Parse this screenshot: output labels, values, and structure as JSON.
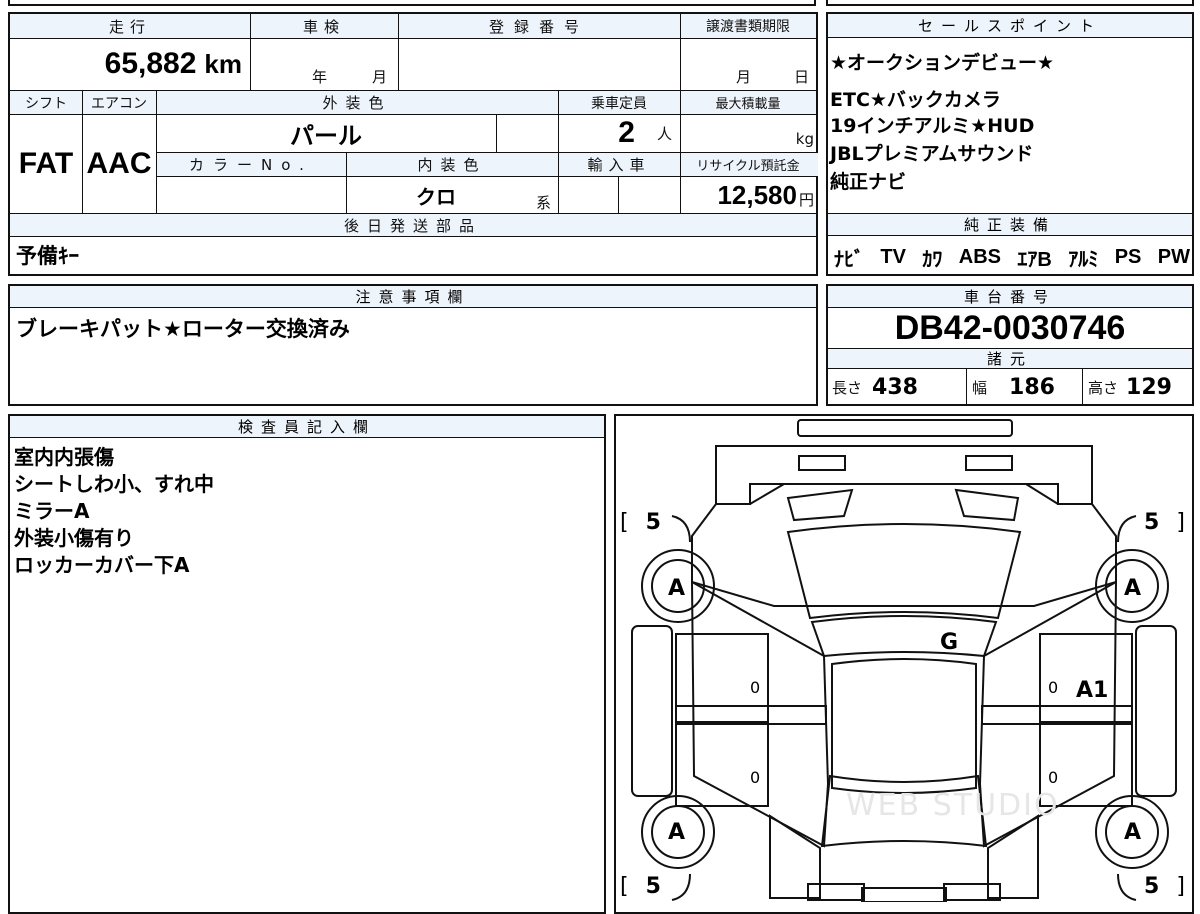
{
  "mileage": {
    "label": "走行",
    "value": "65,882",
    "unit": "km"
  },
  "inspection": {
    "label": "車検",
    "year_label": "年",
    "month_label": "月"
  },
  "registration": {
    "label": "登録番号",
    "value": ""
  },
  "transfer_deadline": {
    "label": "譲渡書類期限",
    "month_label": "月",
    "day_label": "日"
  },
  "shift": {
    "label": "シフト",
    "value": "FAT"
  },
  "aircon": {
    "label": "エアコン",
    "value": "AAC"
  },
  "exterior_color": {
    "label": "外装色",
    "value": "パール"
  },
  "capacity": {
    "label": "乗車定員",
    "value": "2",
    "unit": "人"
  },
  "max_load": {
    "label": "最大積載量",
    "unit": "kg"
  },
  "color_no": {
    "label": "カラーNo."
  },
  "interior_color": {
    "label": "内装色",
    "value": "クロ",
    "suffix": "系"
  },
  "import": {
    "label": "輸入車"
  },
  "recycle": {
    "label": "リサイクル預託金",
    "value": "12,580",
    "unit": "円"
  },
  "sales_points": {
    "label": "セールスポイント",
    "lines": [
      "★オークションデビュー★",
      "",
      "ETC★バックカメラ",
      "19インチアルミ★HUD",
      "JBLプレミアムサウンド",
      "純正ナビ"
    ]
  },
  "later_parts": {
    "label": "後日発送部品",
    "value": "予備ｷｰ"
  },
  "equipment": {
    "label": "純正装備",
    "items": [
      "ﾅﾋﾞ",
      "TV",
      "ｶﾜ",
      "ABS",
      "ｴｱB",
      "ｱﾙﾐ",
      "PS",
      "PW"
    ]
  },
  "notes": {
    "label": "注意事項欄",
    "value": "ブレーキパット★ローター交換済み"
  },
  "chassis": {
    "label": "車台番号",
    "value": "DB42-0030746"
  },
  "specs": {
    "label": "諸元",
    "length_label": "長さ",
    "length": "438",
    "width_label": "幅",
    "width": "186",
    "height_label": "高さ",
    "height": "129"
  },
  "inspector": {
    "label": "検査員記入欄",
    "lines": [
      "室内内張傷",
      "シートしわ小、すれ中",
      "ミラーA",
      "外装小傷有り",
      "ロッカーカバー下A"
    ]
  },
  "diagram": {
    "tire_fl": "5",
    "tire_fr": "5",
    "tire_rl": "5",
    "tire_rr": "5",
    "bracket_open": "[",
    "bracket_close": "]",
    "wheel_fl": "A",
    "wheel_fr": "A",
    "wheel_rl": "A",
    "wheel_rr": "A",
    "windshield": "G",
    "door_fl": "0",
    "door_fr": "0",
    "door_rl": "0",
    "door_rr": "0",
    "door_fr_damage": "A1",
    "watermark": "WEB STUDIO"
  }
}
